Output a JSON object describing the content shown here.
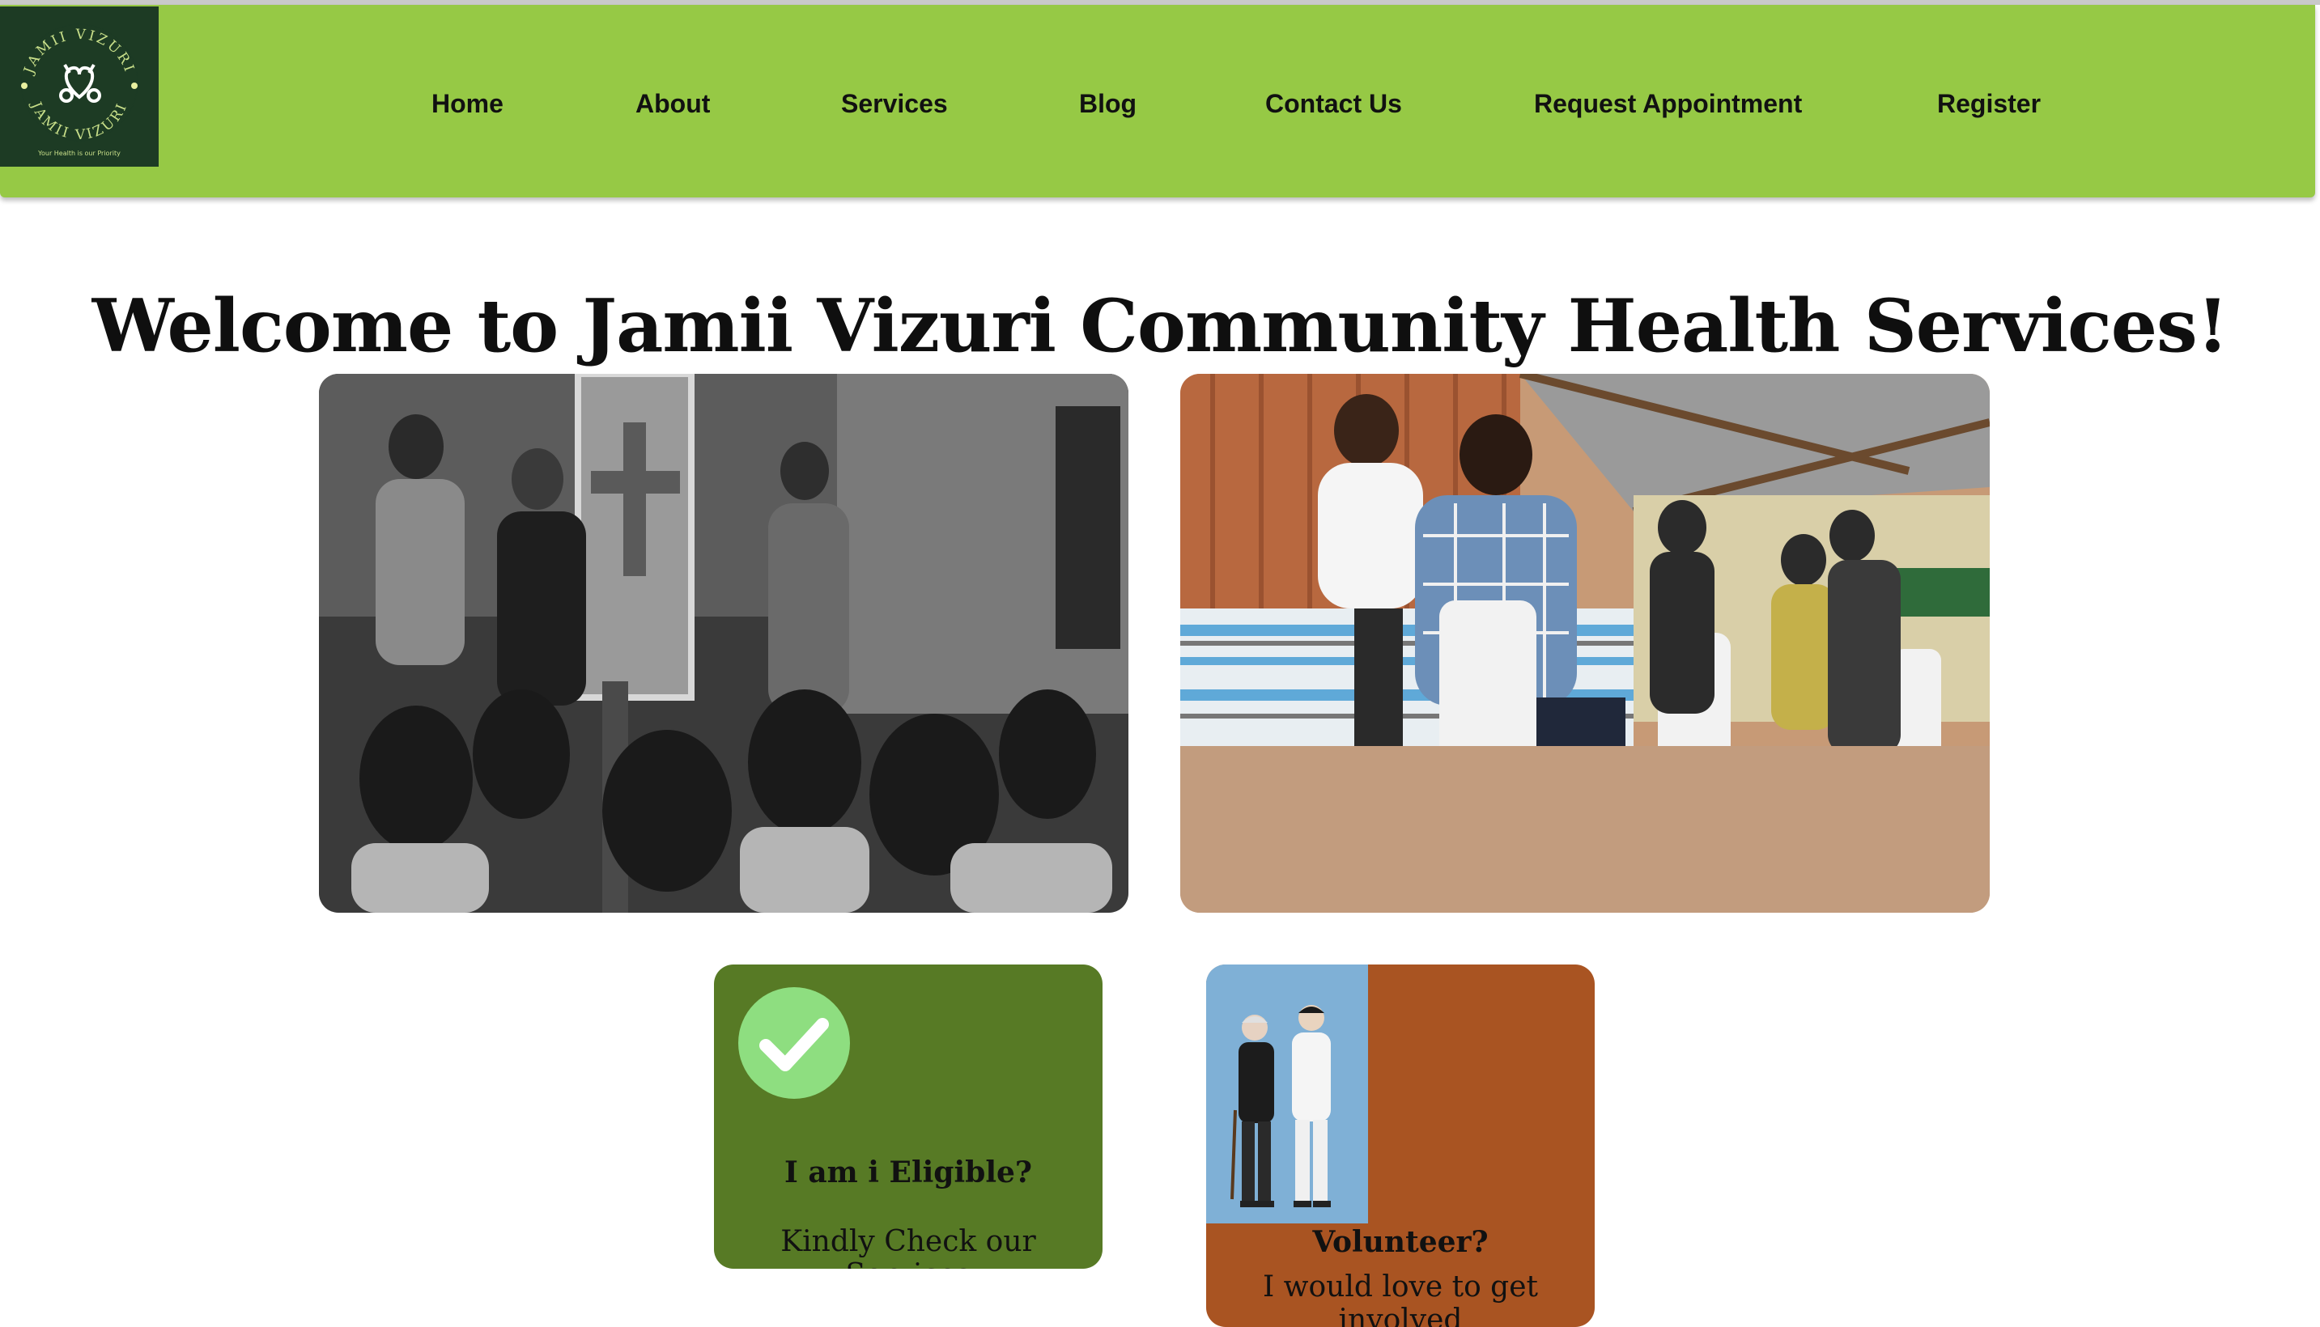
{
  "brand": {
    "logo_text_top": "JAMII VIZURI",
    "logo_text_bottom": "JAMII VIZURI",
    "tagline": "Your Health is our Priority",
    "nav_color": "#96c945",
    "logo_bg": "#1d3b24"
  },
  "nav": {
    "items": [
      {
        "label": "Home"
      },
      {
        "label": "About"
      },
      {
        "label": "Services"
      },
      {
        "label": "Blog"
      },
      {
        "label": "Contact Us"
      },
      {
        "label": "Request Appointment"
      },
      {
        "label": "Register"
      }
    ]
  },
  "main": {
    "heading": "Welcome to Jamii Vizuri Community Health Services!",
    "photos": [
      {
        "icon": "community-gathering-photo"
      },
      {
        "icon": "vaccination-clinic-photo"
      }
    ]
  },
  "cards": {
    "eligible": {
      "title": "I am i Eligible?",
      "subtitle": "Kindly Check our Services",
      "icon": "checkmark-icon",
      "color": "#577a25"
    },
    "volunteer": {
      "title": "Volunteer?",
      "subtitle": "I would love to get involved",
      "icon": "volunteer-illustration",
      "color": "#a95422"
    }
  }
}
